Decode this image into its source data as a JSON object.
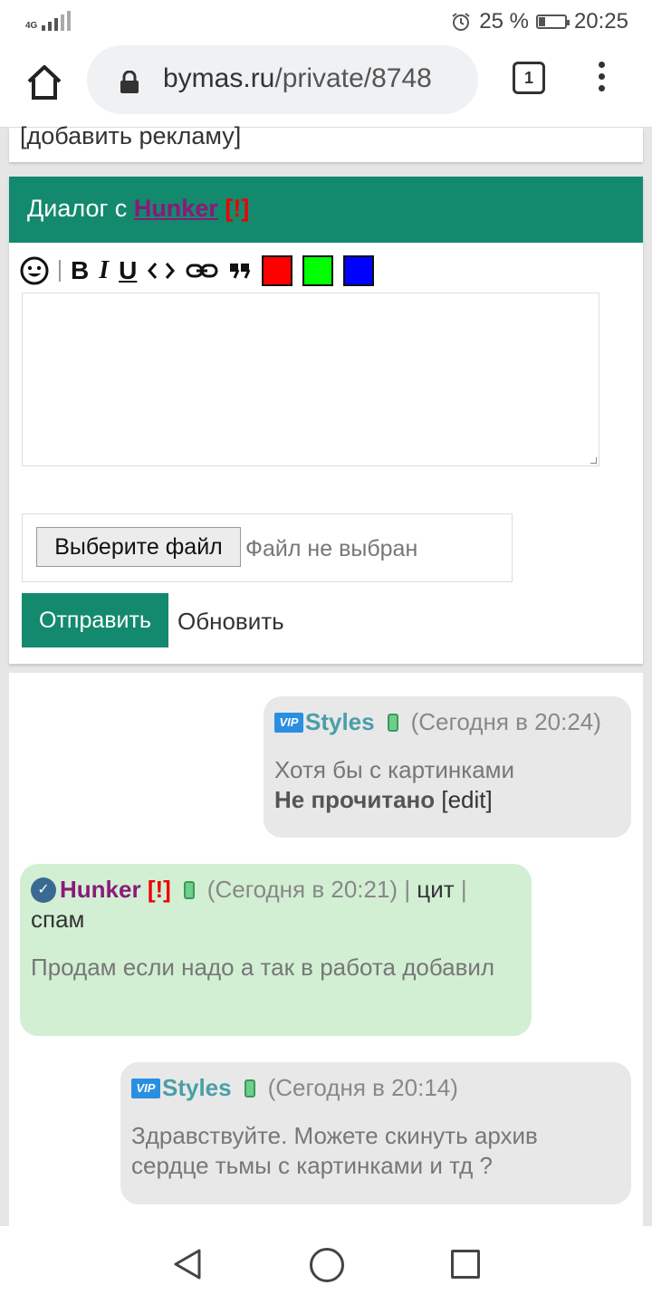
{
  "status": {
    "network": "4G",
    "alarm_icon": "alarm-icon",
    "battery": "25 %",
    "battery_level": 0.25,
    "time": "20:25"
  },
  "browser": {
    "url_host": "bymas.ru",
    "url_path": "/private/8748",
    "tab_count": "1"
  },
  "page": {
    "ad_link": "[добавить рекламу]",
    "dialog": {
      "title_prefix": "Диалог с ",
      "partner": "Hunker",
      "flag": "[!]"
    },
    "toolbar": {
      "items": [
        "smile-icon",
        "bold",
        "italic",
        "underline",
        "code",
        "link",
        "quote"
      ],
      "bold": "B",
      "italic": "I",
      "underline": "U",
      "colors": [
        "#ff0000",
        "#00ff00",
        "#0000ff"
      ]
    },
    "message_placeholder": "",
    "file": {
      "button": "Выберите файл",
      "status": "Файл не выбран"
    },
    "send_label": "Отправить",
    "refresh_label": "Обновить"
  },
  "messages": [
    {
      "author": "Styles",
      "badge": "VIP",
      "time": "(Сегодня в 20:24)",
      "text": "Хотя бы с картинками",
      "status": "Не прочитано",
      "edit": "[edit]"
    },
    {
      "author": "Hunker",
      "flag": "[!]",
      "time": "(Сегодня в 20:21)",
      "sep1": " | ",
      "quote": "цит",
      "sep2": " | ",
      "spam": "спам",
      "text": "Продам если надо а так в работа добавил"
    },
    {
      "author": "Styles",
      "badge": "VIP",
      "time": "(Сегодня в 20:14)",
      "text": "Здравствуйте. Можете скинуть архив сердце тьмы с картинками и тд ?"
    }
  ]
}
